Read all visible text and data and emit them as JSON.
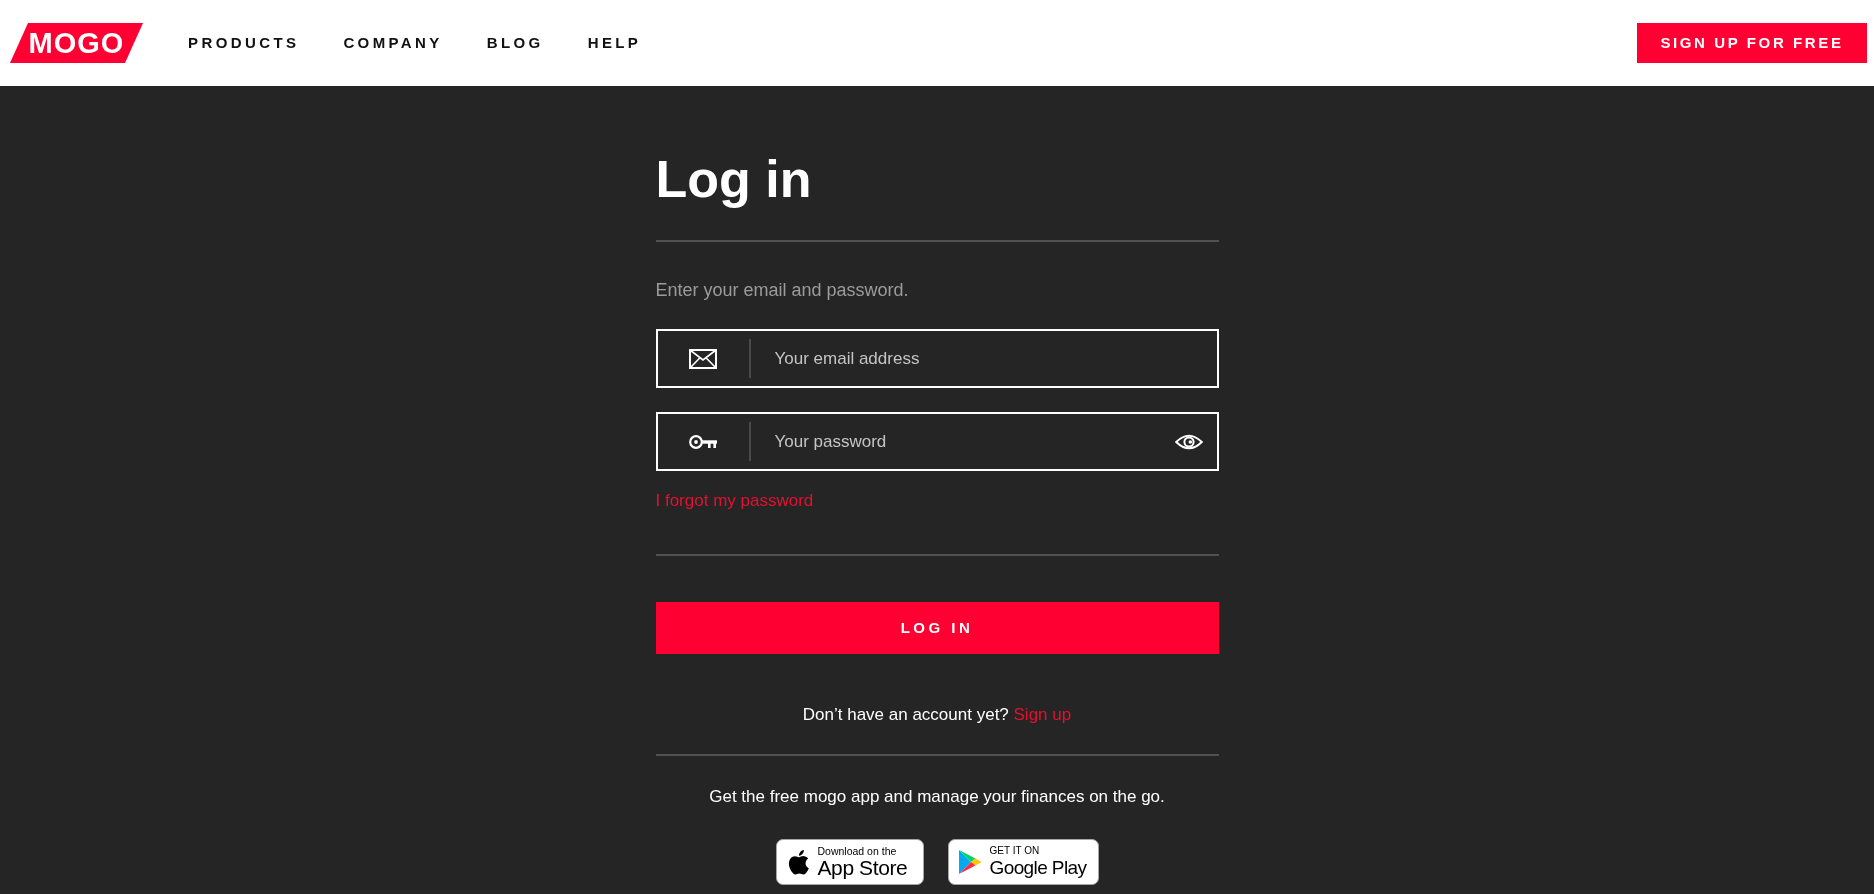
{
  "header": {
    "logo": "MOGO",
    "nav": [
      "PRODUCTS",
      "COMPANY",
      "BLOG",
      "HELP"
    ],
    "signup_button": "SIGN UP FOR FREE"
  },
  "login": {
    "title": "Log in",
    "subtitle": "Enter your email and password.",
    "fields": [
      {
        "kind": "email",
        "placeholder": "Your email address"
      },
      {
        "kind": "password",
        "placeholder": "Your password"
      }
    ],
    "forgot_link": "I forgot my password",
    "submit_button": "LOG IN",
    "signup_prompt": {
      "text": "Don’t have an account yet?",
      "link": "Sign up"
    },
    "app_promo": "Get the free mogo app and manage your finances on the go.",
    "store_badges": [
      {
        "kind": "app_store",
        "small": "Download on the",
        "large": "App Store"
      },
      {
        "kind": "google_play",
        "small": "GET IT ON",
        "large": "Google Play"
      }
    ]
  }
}
